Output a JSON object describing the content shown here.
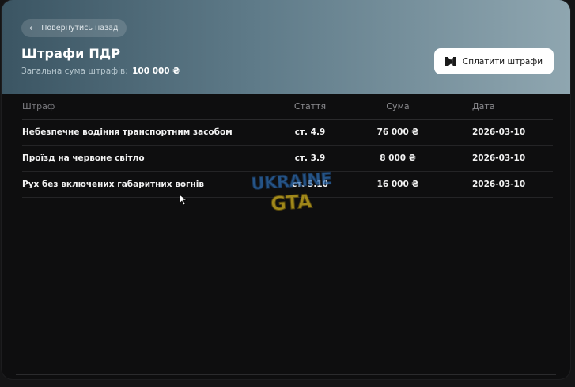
{
  "header": {
    "back_label": "Повернутись назад",
    "title": "Штрафи ПДР",
    "total_label": "Загальна сума штрафів:",
    "total_amount": "100 000 ₴",
    "pay_label": "Сплатити штрафи"
  },
  "table": {
    "columns": {
      "name": "Штраф",
      "article": "Стаття",
      "sum": "Сума",
      "date": "Дата"
    },
    "rows": [
      {
        "name": "Небезпечне водіння транспортним засобом",
        "article": "ст. 4.9",
        "sum": "76 000 ₴",
        "date": "2026-03-10"
      },
      {
        "name": "Проїзд на червоне світло",
        "article": "ст. 3.9",
        "sum": "8 000 ₴",
        "date": "2026-03-10"
      },
      {
        "name": "Рух без включених габаритних вогнів",
        "article": "ст. 5.10",
        "sum": "16 000 ₴",
        "date": "2026-03-10"
      }
    ]
  },
  "watermark": {
    "line1": "UKRAINE",
    "line2": "GTA"
  },
  "colors": {
    "header_start": "#3b5563",
    "header_end": "#8fa6b0",
    "background": "#0e0e0f",
    "watermark_blue": "#2f6fb6",
    "watermark_yellow": "#d9b81f"
  }
}
